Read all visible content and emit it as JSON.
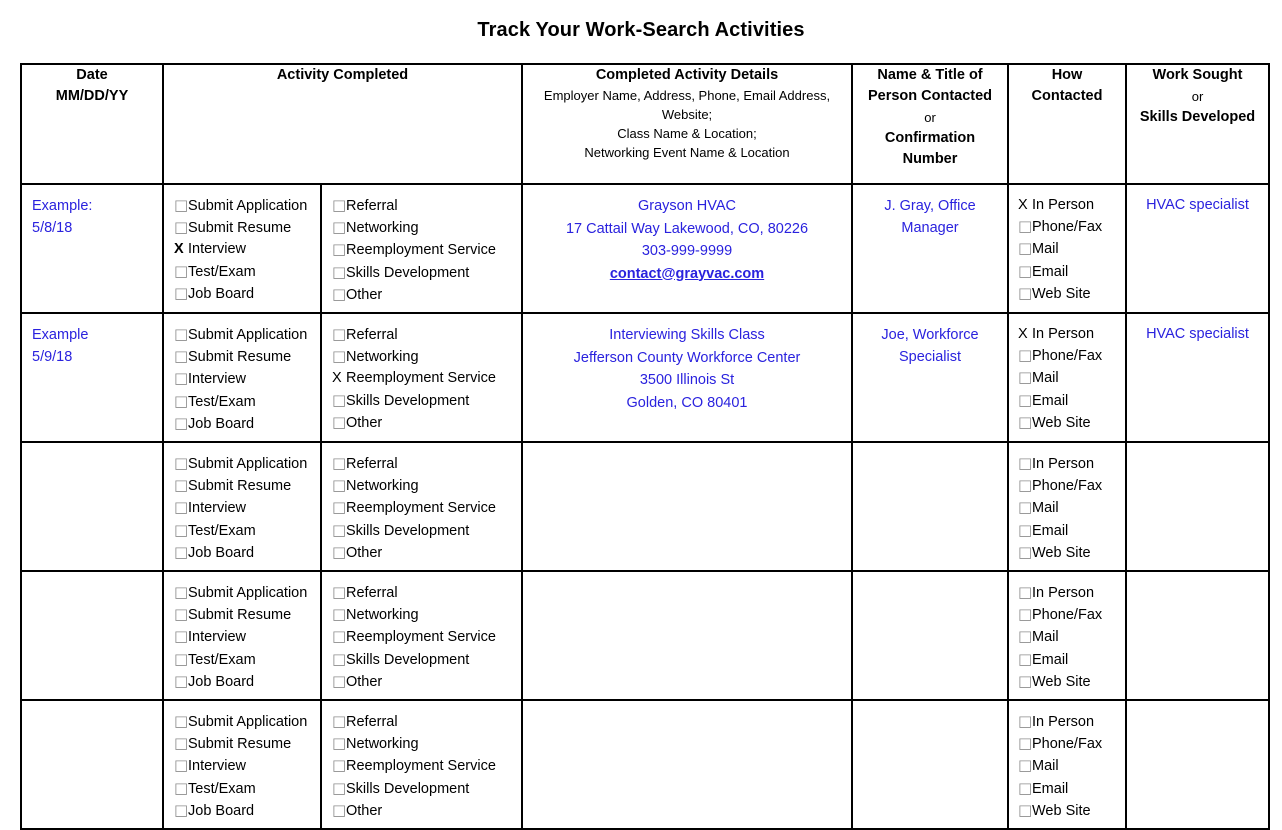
{
  "page": {
    "title": "Track Your Work-Search Activities",
    "accent_blue": "#2a22de",
    "border_color": "#000000",
    "checkbox_glyph": "□",
    "check_mark": "X"
  },
  "table": {
    "headers": {
      "date": {
        "line1": "Date",
        "line2": "MM/DD/YY"
      },
      "activity": {
        "line1": "Activity Completed"
      },
      "details": {
        "line1": "Completed Activity Details",
        "line2": "Employer Name, Address, Phone, Email Address,",
        "line3": "Website;",
        "line4": "Class Name & Location;",
        "line5": "Networking Event Name & Location"
      },
      "person": {
        "line1": "Name & Title of",
        "line2": "Person Contacted",
        "line3": "or",
        "line4": "Confirmation",
        "line5": "Number"
      },
      "how": {
        "line1": "How",
        "line2": "Contacted"
      },
      "work": {
        "line1": "Work Sought",
        "line2": "or",
        "line3": "Skills Developed"
      }
    },
    "activity_options_left": [
      "Submit Application",
      "Submit Resume",
      "Interview",
      "Test/Exam",
      "Job Board"
    ],
    "activity_options_right": [
      "Referral",
      "Networking",
      "Reemployment Service",
      "Skills Development",
      "Other"
    ],
    "contact_options": [
      "In Person",
      "Phone/Fax",
      "Mail",
      "Email",
      "Web Site"
    ],
    "rows": [
      {
        "date_lines": [
          "Example:",
          "5/8/18"
        ],
        "checked_left": [
          2
        ],
        "checked_right": [],
        "detail_lines": [
          {
            "text": "Grayson HVAC",
            "link": false
          },
          {
            "text": "17 Cattail Way Lakewood, CO, 80226",
            "link": false
          },
          {
            "text": "303-999-9999",
            "link": false
          },
          {
            "text": "contact@grayvac.com",
            "link": true
          }
        ],
        "person_lines": [
          "J. Gray, Office",
          "Manager"
        ],
        "checked_contact": [
          0
        ],
        "work_sought": "HVAC specialist"
      },
      {
        "date_lines": [
          "Example",
          "5/9/18"
        ],
        "checked_left": [],
        "checked_right": [
          2
        ],
        "detail_lines": [
          {
            "text": "Interviewing Skills Class",
            "link": false
          },
          {
            "text": "Jefferson County Workforce Center",
            "link": false
          },
          {
            "text": "3500 Illinois St",
            "link": false
          },
          {
            "text": "Golden, CO 80401",
            "link": false
          }
        ],
        "person_lines": [
          "Joe, Workforce",
          "Specialist"
        ],
        "checked_contact": [
          0
        ],
        "work_sought": "HVAC specialist"
      },
      {
        "date_lines": [],
        "checked_left": [],
        "checked_right": [],
        "detail_lines": [],
        "person_lines": [],
        "checked_contact": [],
        "work_sought": ""
      },
      {
        "date_lines": [],
        "checked_left": [],
        "checked_right": [],
        "detail_lines": [],
        "person_lines": [],
        "checked_contact": [],
        "work_sought": ""
      },
      {
        "date_lines": [],
        "checked_left": [],
        "checked_right": [],
        "detail_lines": [],
        "person_lines": [],
        "checked_contact": [],
        "work_sought": ""
      }
    ]
  }
}
